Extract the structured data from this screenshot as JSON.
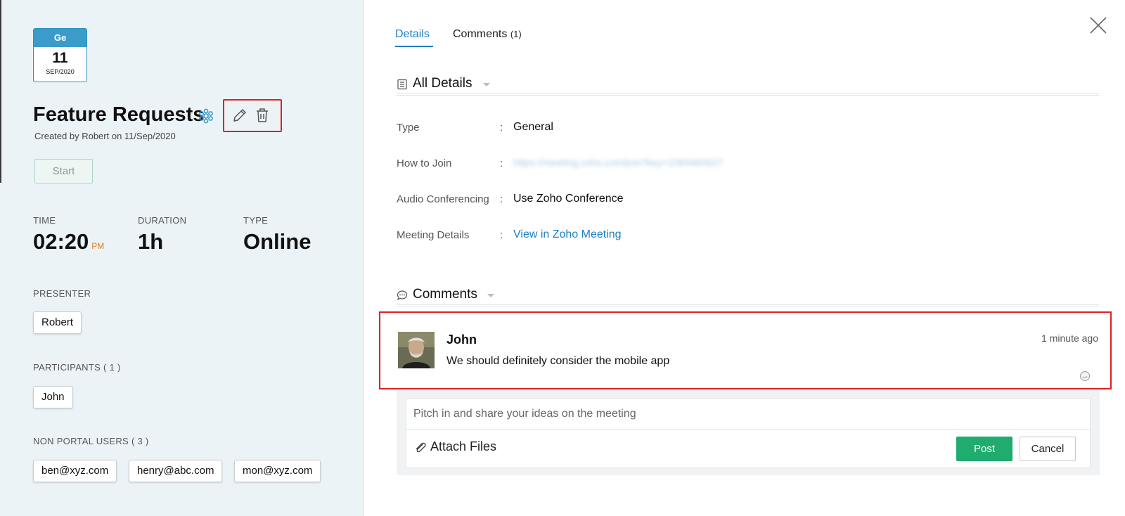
{
  "event": {
    "calendar": {
      "weekday": "Ge",
      "day": "11",
      "month": "SEP/2020"
    },
    "title": "Feature Requests",
    "created_by": "Created by Robert on 11/Sep/2020",
    "start_label": "Start",
    "time_label": "TIME",
    "time_value": "02:20",
    "time_ampm": "PM",
    "duration_label": "DURATION",
    "duration_value": "1h",
    "type_label": "TYPE",
    "type_value": "Online",
    "presenter_label": "PRESENTER",
    "presenter": "Robert",
    "participants_label": "PARTICIPANTS ( 1 )",
    "participants": [
      "John"
    ],
    "non_portal_label": "NON PORTAL USERS ( 3 )",
    "non_portal_users": [
      "ben@xyz.com",
      "henry@abc.com",
      "mon@xyz.com"
    ]
  },
  "tabs": [
    {
      "label": "Details",
      "count": ""
    },
    {
      "label": "Comments",
      "count": "(1)"
    }
  ],
  "details": {
    "heading": "All Details",
    "fields": [
      {
        "label": "Type",
        "value": "General"
      },
      {
        "label": "How to Join",
        "value": "https://meeting.zoho.com/join?key=1084460627"
      },
      {
        "label": "Audio Conferencing",
        "value": "Use Zoho Conference"
      },
      {
        "label": "Meeting Details",
        "value": "View in Zoho Meeting"
      }
    ]
  },
  "comments": {
    "heading": "Comments",
    "items": [
      {
        "author": "John",
        "time": "1 minute ago",
        "text": "We should definitely consider the mobile app"
      }
    ],
    "placeholder": "Pitch in and share your ideas on the meeting",
    "attach_label": "Attach Files",
    "post_label": "Post",
    "cancel_label": "Cancel"
  },
  "colors": {
    "accent": "#1f7ec4",
    "post_button": "#1fac6e",
    "highlight_box": "#e02020",
    "pm_text": "#e07a1f"
  }
}
